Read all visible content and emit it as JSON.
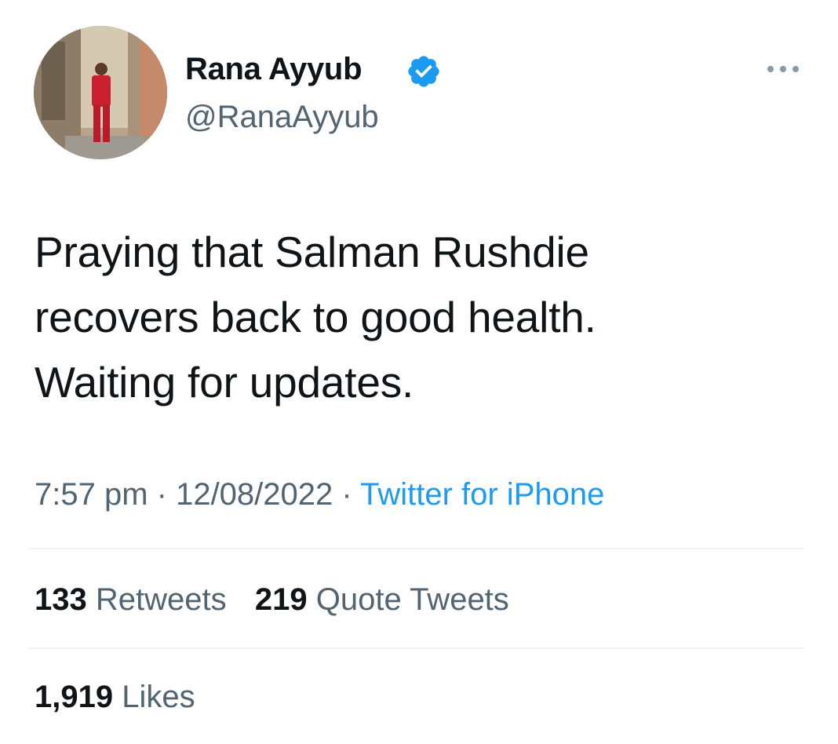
{
  "author": {
    "display_name": "Rana Ayyub",
    "handle": "@RanaAyyub",
    "verified": true,
    "avatar_icon": "profile-photo"
  },
  "tweet": {
    "lines": [
      "Praying that Salman Rushdie",
      "recovers back to good health.",
      "Waiting for updates."
    ]
  },
  "meta": {
    "time": "7:57 pm",
    "separator": " · ",
    "date": "12/08/2022",
    "source": "Twitter for iPhone"
  },
  "stats": {
    "retweets_count": "133",
    "retweets_label": " Retweets",
    "quotes_count": "219",
    "quotes_label": " Quote Tweets",
    "likes_count": "1,919",
    "likes_label": " Likes"
  },
  "colors": {
    "text": "#0f1419",
    "secondary": "#536471",
    "accent": "#1d9bf0",
    "divider": "#eff3f4"
  }
}
